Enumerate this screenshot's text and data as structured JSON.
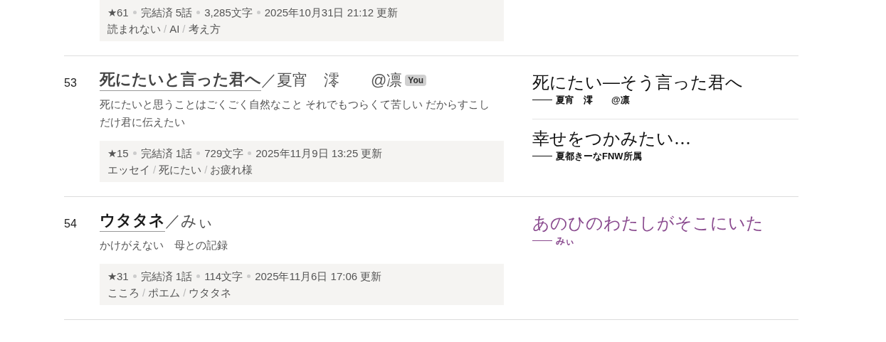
{
  "tag_separator": "/",
  "rows": [
    {
      "meta": [
        "★61",
        "完結済 5話",
        "3,285文字",
        "2025年10月31日 21:12 更新"
      ],
      "tags": [
        "読まれない",
        "AI",
        "考え方"
      ],
      "picks": []
    },
    {
      "rank": "53",
      "title": "死にたいと言った君へ",
      "visited": true,
      "author": "／夏宵　澪　　@凛",
      "badge": "You",
      "description": "死にたいと思うことはごくごく自然なこと それでもつらくて苦しい だからすこしだけ君に伝えたい",
      "meta": [
        "★15",
        "完結済 1話",
        "729文字",
        "2025年11月9日 13:25 更新"
      ],
      "tags": [
        "エッセイ",
        "死にたい",
        "お疲れ様"
      ],
      "picks": [
        {
          "title": "死にたい―そう言った君へ",
          "byline": "夏宵　澪　　@凛",
          "color": "#111111"
        },
        {
          "title": "幸せをつかみたい…",
          "byline": "夏都きーなFNW所属",
          "color": "#111111"
        }
      ]
    },
    {
      "rank": "54",
      "title": "ウタタネ",
      "visited": false,
      "author": "／みぃ",
      "description": "かけがえない　母との記録",
      "meta": [
        "★31",
        "完結済 1話",
        "114文字",
        "2025年11月6日 17:06 更新"
      ],
      "tags": [
        "こころ",
        "ポエム",
        "ウタタネ"
      ],
      "picks": [
        {
          "title": "あのひのわたしがそこにいた",
          "byline": "みぃ",
          "color": "#8a4b8f"
        }
      ]
    }
  ]
}
